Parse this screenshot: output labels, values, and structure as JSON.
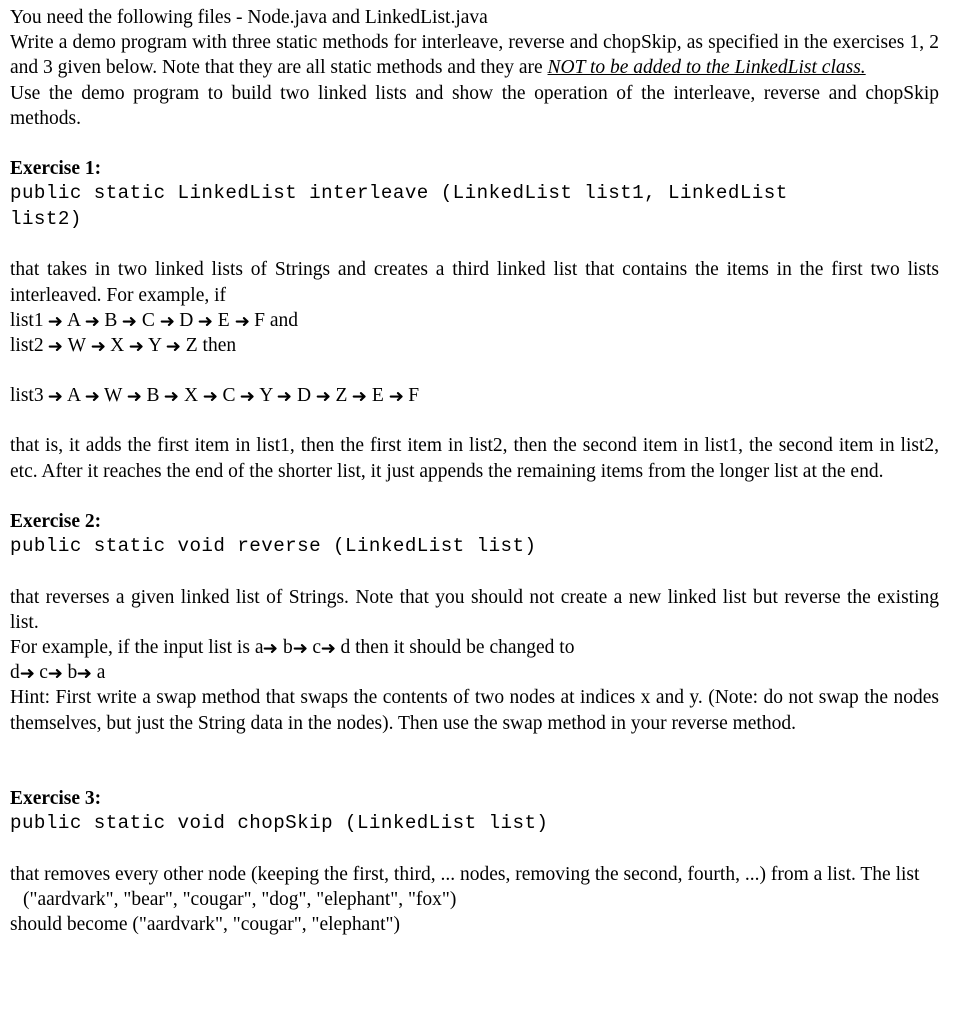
{
  "document": {
    "intro": {
      "line1": "You need the following files - Node.java and LinkedList.java",
      "para_a_pre": "Write a demo program with three static methods for interleave, reverse and chopSkip, as specified in the exercises 1, 2 and 3 given below. Note that they are all static methods and they are ",
      "para_a_emph": "NOT to be added to the LinkedList class.",
      "para_b": "Use the demo program to build two linked lists and show the operation of the interleave, reverse and chopSkip methods."
    },
    "exercise1": {
      "heading": "Exercise 1:",
      "signature": "public static LinkedList interleave (LinkedList list1, LinkedList\nlist2)",
      "body1": "that takes in two linked lists of Strings and creates a third linked list that contains the items in the first two lists interleaved. For example, if",
      "list1_label": "list1",
      "list1_items": [
        "A",
        "B",
        "C",
        "D",
        "E",
        "F"
      ],
      "list1_suffix": "and",
      "list2_label": "list2",
      "list2_items": [
        "W",
        "X",
        "Y",
        "Z"
      ],
      "list2_suffix": "then",
      "list3_label": "list3",
      "list3_items": [
        "A",
        "W",
        "B",
        "X",
        "C",
        "Y",
        "D",
        "Z",
        "E",
        "F"
      ],
      "body2": "that is, it adds the first item in list1, then the first item in list2, then the second item in list1, the second item in list2, etc. After it reaches the end of the shorter list, it just appends the remaining items from the longer list at the end."
    },
    "exercise2": {
      "heading": "Exercise 2:",
      "signature": "public static void reverse (LinkedList list)",
      "body1": "that reverses a given linked list of Strings. Note that you should not create a new linked list but reverse the existing list.",
      "example_prefix": "For example, if the input list is",
      "example_input": [
        "a",
        "b",
        "c",
        "d"
      ],
      "example_mid": "then it should be changed to",
      "example_output": [
        "d",
        "c",
        "b",
        "a"
      ],
      "hint": "Hint: First write a swap method that swaps the contents of two nodes at indices x and y. (Note: do not swap the nodes themselves, but just the String data in the nodes). Then use the swap method in your reverse method."
    },
    "exercise3": {
      "heading": "Exercise 3:",
      "signature": "public static void chopSkip (LinkedList list)",
      "body1": "that removes every other node (keeping the first, third, ... nodes, removing the second, fourth, ...) from a list. The list",
      "sample_list": "(\"aardvark\", \"bear\", \"cougar\", \"dog\", \"elephant\", \"fox\")",
      "result_line": "should become (\"aardvark\", \"cougar\", \"elephant\")"
    },
    "glyphs": {
      "arrow": "➜"
    },
    "colors": {
      "text": "#000000",
      "background": "#ffffff"
    }
  }
}
